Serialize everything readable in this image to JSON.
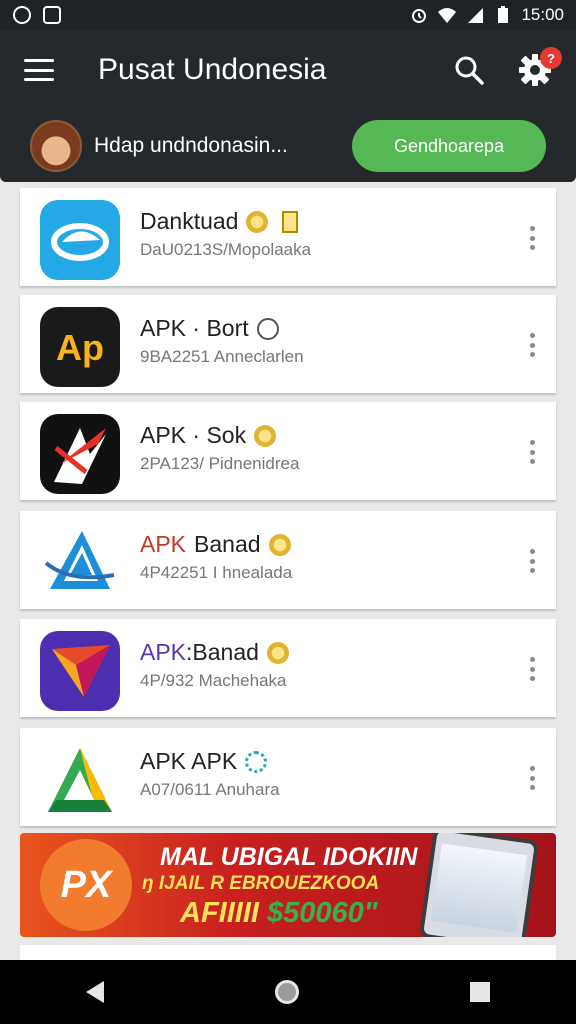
{
  "status_bar": {
    "time": "15:00"
  },
  "header": {
    "title": "Pusat Undonesia",
    "notification_count": "?",
    "user_text": "Hdap undndonasin...",
    "primary_button": "Gendhoarepa"
  },
  "apps": [
    {
      "name": "Danktuad",
      "subtitle": "DaU0213S/Mopolaaka",
      "icon": "blue-bird-icon"
    },
    {
      "name": "APK · Bort",
      "subtitle": "9BA2251 Anneclarlen",
      "icon": "ap-logo-icon"
    },
    {
      "name": "APK · Sok",
      "subtitle": "2PA123/ Pidnenidrea",
      "icon": "red-arrow-icon"
    },
    {
      "name_prefix": "APK",
      "name_suffix": "Banad",
      "subtitle": "4P42251 I hnealada",
      "icon": "blue-a-icon"
    },
    {
      "name_prefix": "APK",
      "name_suffix": ":Banad",
      "subtitle": "4P/932 Machehaka",
      "icon": "purple-plane-icon"
    },
    {
      "name": "APK APK",
      "subtitle": "A07/0611 Anuhara",
      "icon": "green-triangle-icon"
    }
  ],
  "ad": {
    "logo": "PX",
    "line1": "MAL UBIGAL IDOKIIN",
    "line2": "ŋ IJAIL R EBROUEZKOOA",
    "line3_text": "AFIIIII",
    "line3_price": "$50060\""
  },
  "colors": {
    "header_bg": "#25292c",
    "accent_green": "#56b755",
    "badge_red": "#e53935"
  }
}
